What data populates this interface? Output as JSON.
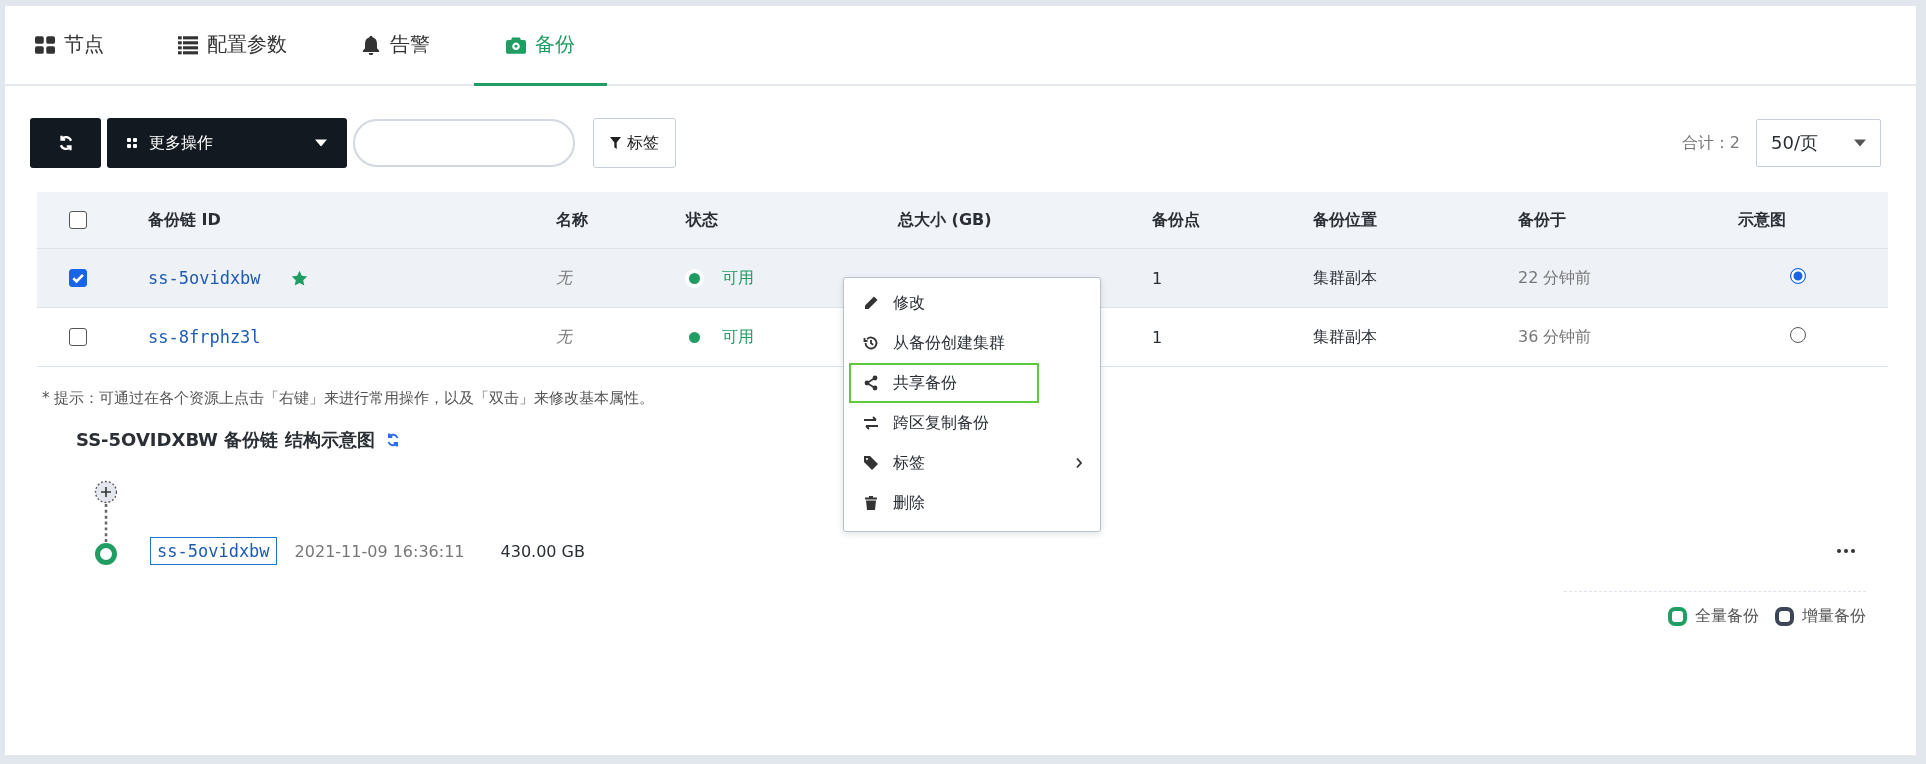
{
  "tabs": [
    {
      "label": "节点",
      "selected": false
    },
    {
      "label": "配置参数",
      "selected": false
    },
    {
      "label": "告警",
      "selected": false
    },
    {
      "label": "备份",
      "selected": true
    }
  ],
  "toolbar": {
    "more_actions": "更多操作",
    "tag_filter": "标签",
    "total": "合计：2",
    "page_size": "50/页"
  },
  "table": {
    "columns": [
      "备份链 ID",
      "名称",
      "状态",
      "总大小 (GB)",
      "备份点",
      "备份位置",
      "备份于",
      "示意图"
    ],
    "all_checked": false,
    "rows": [
      {
        "checked": true,
        "starred": true,
        "id": "ss-5ovidxbw",
        "name": "无",
        "status": "可用",
        "points": "1",
        "location": "集群副本",
        "time": "22 分钟前",
        "diagram_selected": true
      },
      {
        "checked": false,
        "starred": false,
        "id": "ss-8frphz3l",
        "name": "无",
        "status": "可用",
        "points": "1",
        "location": "集群副本",
        "time": "36 分钟前",
        "diagram_selected": false
      }
    ]
  },
  "context_menu": [
    {
      "label": "修改",
      "highlighted": false,
      "submenu": false
    },
    {
      "label": "从备份创建集群",
      "highlighted": false,
      "submenu": false
    },
    {
      "label": "共享备份",
      "highlighted": true,
      "submenu": false
    },
    {
      "label": "跨区复制备份",
      "highlighted": false,
      "submenu": false
    },
    {
      "label": "标签",
      "highlighted": false,
      "submenu": true
    },
    {
      "label": "删除",
      "highlighted": false,
      "submenu": false
    }
  ],
  "hint": "* 提示：可通过在各个资源上点击「右键」来进行常用操作，以及「双击」来修改基本属性。",
  "diagram": {
    "title": "SS-5OVIDXBW 备份链 结构示意图",
    "node": {
      "id": "ss-5ovidxbw",
      "date": "2021-11-09 16:36:11",
      "size": "430.00 GB",
      "color": "#1f9d62"
    },
    "legend": [
      {
        "label": "全量备份",
        "color": "#1f9d62"
      },
      {
        "label": "增量备份",
        "color": "#3b4556"
      }
    ]
  }
}
